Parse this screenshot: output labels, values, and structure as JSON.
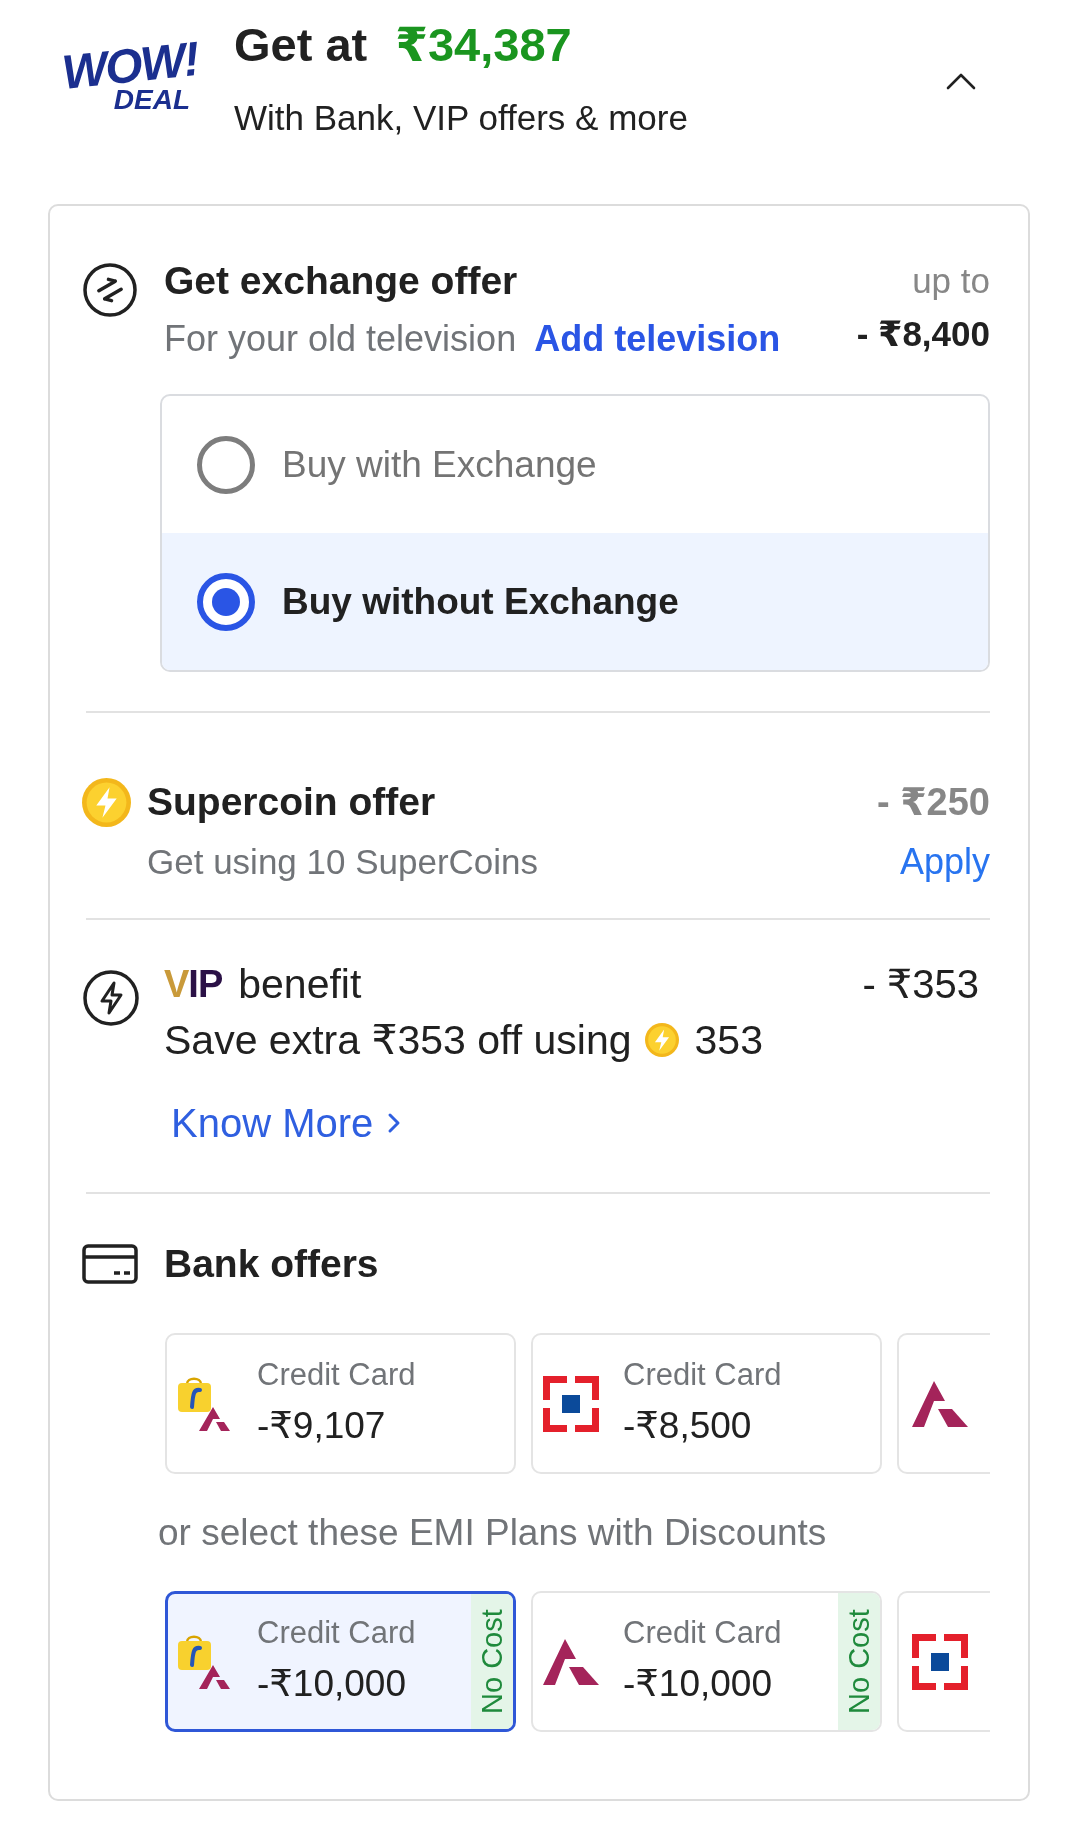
{
  "header": {
    "logo": {
      "line_1": "WOW!",
      "line_2": "DEAL"
    },
    "label": "Get at",
    "price": "₹34,387",
    "subtitle": "With Bank, VIP offers & more",
    "expanded": true
  },
  "exchange": {
    "title": "Get exchange offer",
    "subtitle": "For your old television",
    "link": "Add television",
    "prefix": "up to",
    "amount": "- ₹8,400",
    "options": [
      {
        "label": "Buy with Exchange",
        "selected": false
      },
      {
        "label": "Buy without Exchange",
        "selected": true
      }
    ]
  },
  "supercoin": {
    "title": "Supercoin offer",
    "subtitle": "Get using 10 SuperCoins",
    "amount": "- ₹250",
    "action": "Apply"
  },
  "vip": {
    "logo": "VIP",
    "title": "benefit",
    "amount": "- ₹353",
    "text": "Save extra ₹353 off using",
    "coins": "353",
    "link": "Know More"
  },
  "bank_offers": {
    "title": "Bank offers",
    "offers": [
      {
        "kind": "bag",
        "label": "Credit Card",
        "amount": "-₹9,107",
        "selected": false
      },
      {
        "kind": "square",
        "label": "Credit Card",
        "amount": "-₹8,500",
        "selected": false
      },
      {
        "kind": "peak",
        "selected": false
      }
    ],
    "emi_label": "or select these EMI Plans with Discounts",
    "emi_plans": [
      {
        "kind": "bag",
        "label": "Credit Card",
        "amount": "-₹10,000",
        "badge": "No Cost",
        "selected": true
      },
      {
        "kind": "peak",
        "label": "Credit Card",
        "amount": "-₹10,000",
        "badge": "No Cost",
        "selected": false
      },
      {
        "kind": "square",
        "selected": false
      }
    ]
  }
}
